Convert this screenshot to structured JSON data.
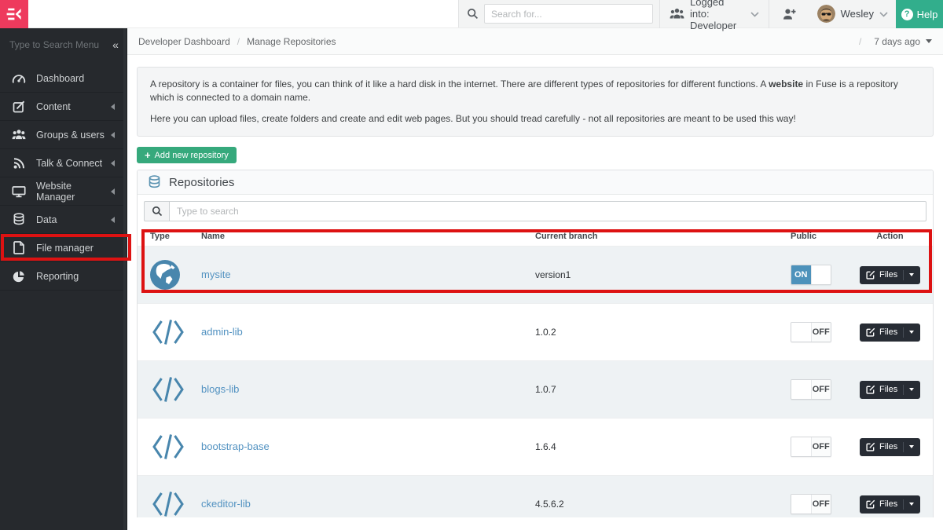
{
  "colors": {
    "brand_pink": "#ee3a5d",
    "accent_teal_help": "#32ae8c",
    "accent_green_add": "#36a97c",
    "link_blue": "#5292c1",
    "toggle_on_blue": "#4d92bb",
    "dark_button": "#272c34",
    "sidebar_bg": "#26292d",
    "row_shaded": "#eef2f4",
    "highlight_red": "#dd1212"
  },
  "topbar": {
    "search_placeholder": "Search for...",
    "logged_into": "Logged into: Developer",
    "username": "Wesley",
    "help_label": "Help",
    "help_icon_glyph": "?"
  },
  "sidebar": {
    "search_placeholder": "Type to Search Menu",
    "collapse_glyph": "«",
    "items": [
      {
        "label": "Dashboard",
        "icon": "dashboard-icon",
        "caret": false
      },
      {
        "label": "Content",
        "icon": "content-icon",
        "caret": true
      },
      {
        "label": "Groups & users",
        "icon": "groups-icon",
        "caret": true
      },
      {
        "label": "Talk & Connect",
        "icon": "talk-icon",
        "caret": true
      },
      {
        "label": "Website Manager",
        "icon": "website-icon",
        "caret": true
      },
      {
        "label": "Data",
        "icon": "data-icon",
        "caret": true
      },
      {
        "label": "File manager",
        "icon": "file-icon",
        "caret": false,
        "highlighted": true
      },
      {
        "label": "Reporting",
        "icon": "reporting-icon",
        "caret": false
      }
    ]
  },
  "breadcrumb": {
    "separator": "/",
    "items": [
      "Developer Dashboard",
      "Manage Repositories"
    ],
    "timestamp": "7 days ago"
  },
  "info_box": {
    "p1_before": "A repository is a container for files, you can think of it like a hard disk in the internet. There are different types of repositories for different functions. A ",
    "p1_bold": "website",
    "p1_after": " in Fuse is a repository which is connected to a domain name.",
    "p2": "Here you can upload files, create folders and create and edit web pages. But you should tread carefully - not all repositories are meant to be used this way!"
  },
  "add_repository": {
    "plus_glyph": "+",
    "label": "Add new repository"
  },
  "panel": {
    "title": "Repositories",
    "search_placeholder": "Type to search"
  },
  "table": {
    "headers": [
      "Type",
      "Name",
      "Current branch",
      "Public",
      "Action"
    ],
    "files_label": "Files",
    "rows": [
      {
        "icon": "globe-icon",
        "name": "mysite",
        "branch": "version1",
        "public": "ON",
        "highlighted": true
      },
      {
        "icon": "code-icon",
        "name": "admin-lib",
        "branch": "1.0.2",
        "public": "OFF"
      },
      {
        "icon": "code-icon",
        "name": "blogs-lib",
        "branch": "1.0.7",
        "public": "OFF"
      },
      {
        "icon": "code-icon",
        "name": "bootstrap-base",
        "branch": "1.6.4",
        "public": "OFF"
      },
      {
        "icon": "code-icon",
        "name": "ckeditor-lib",
        "branch": "4.5.6.2",
        "public": "OFF"
      }
    ]
  }
}
